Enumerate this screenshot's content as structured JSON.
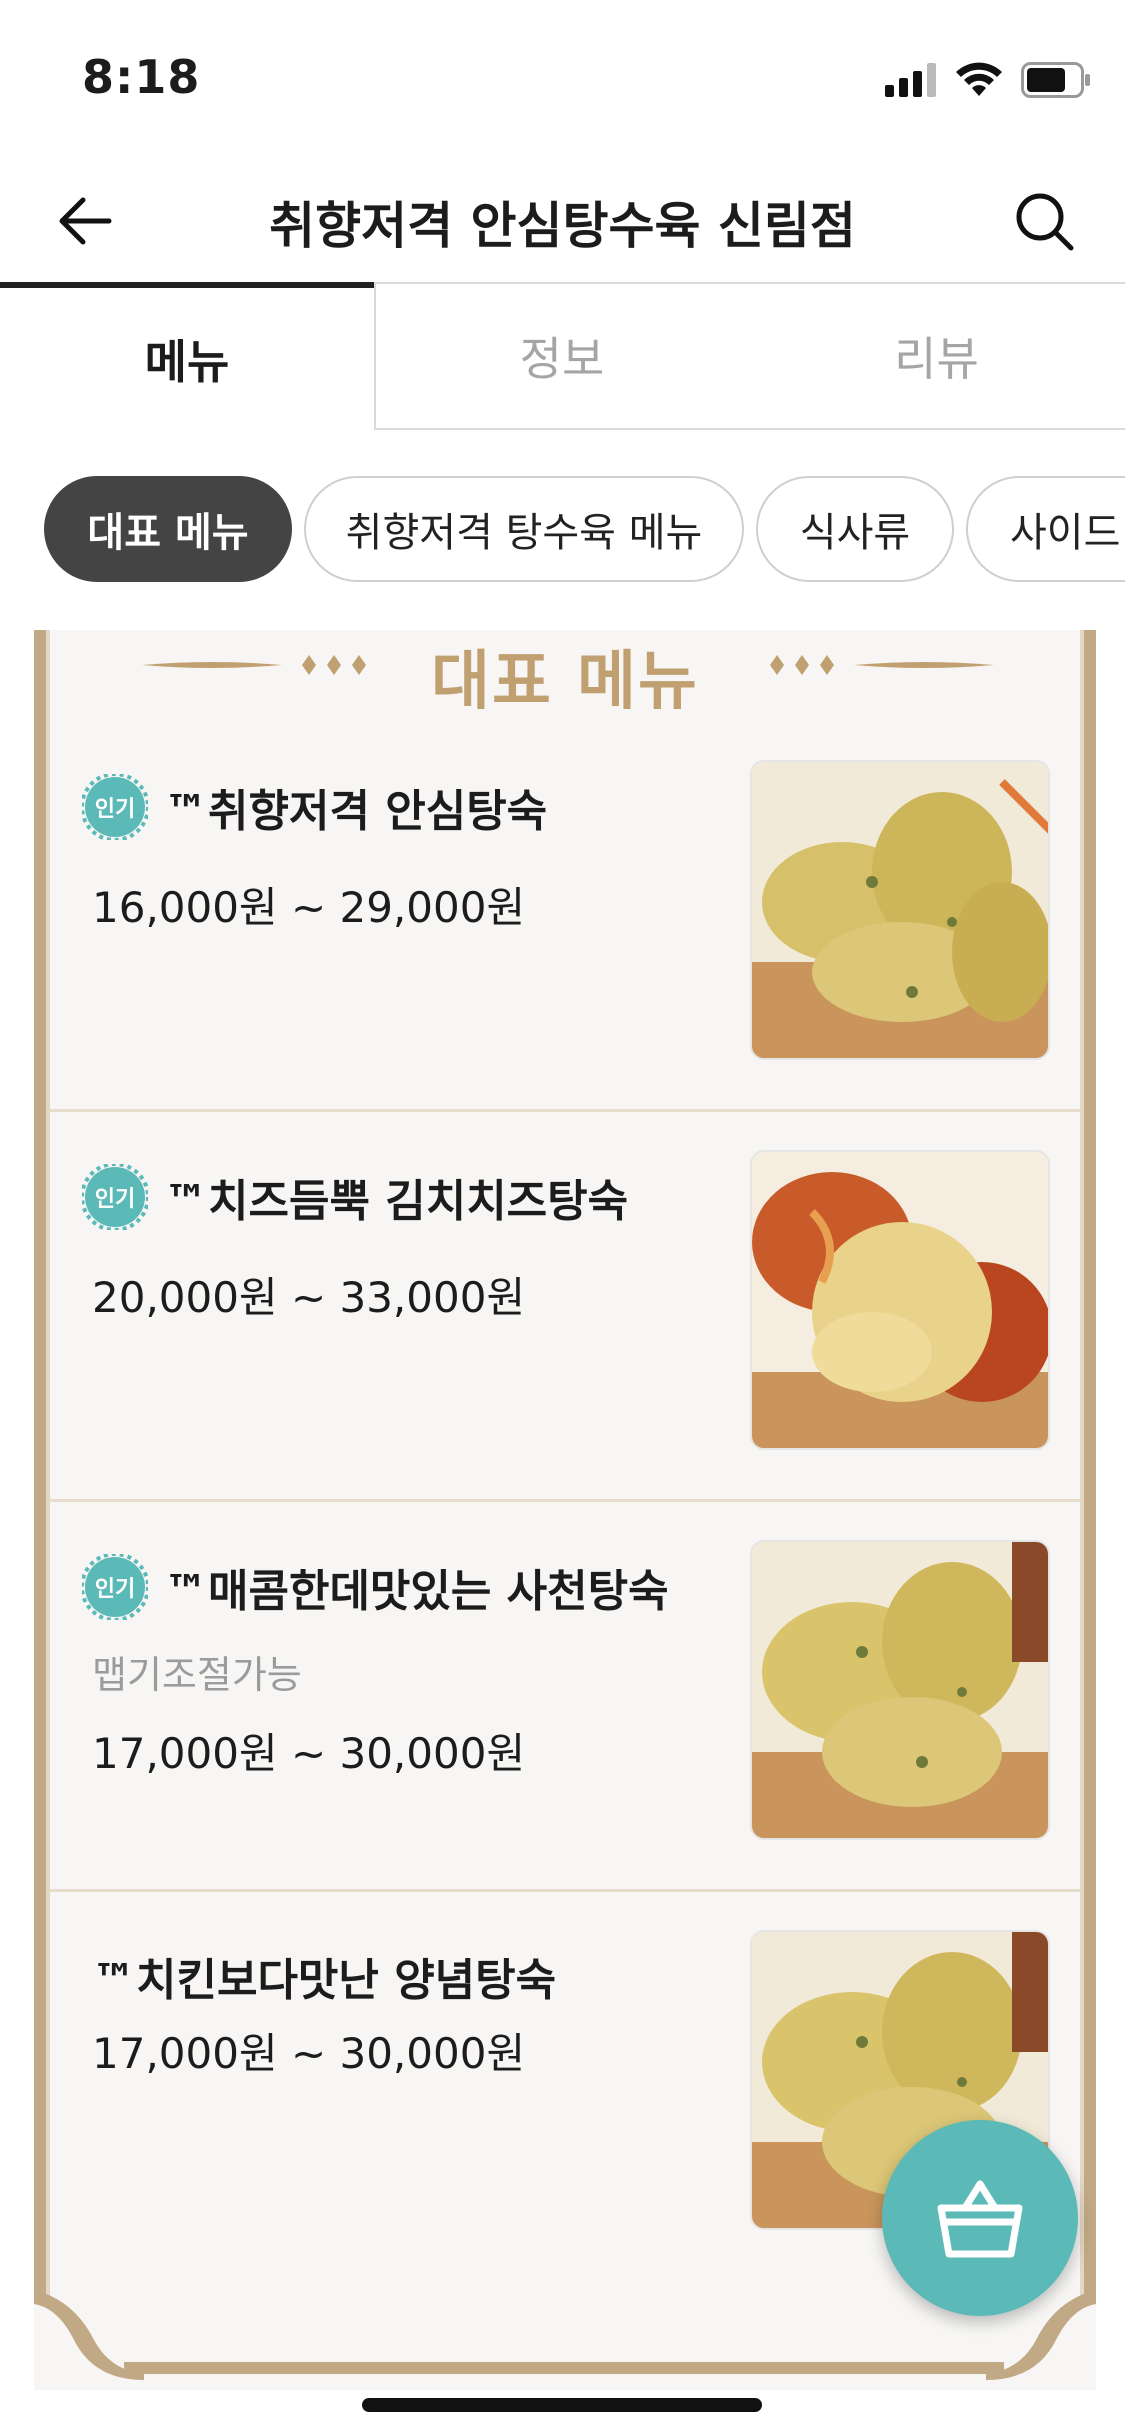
{
  "status": {
    "time": "8:18"
  },
  "header": {
    "title": "취향저격 안심탕수육 신림점"
  },
  "tabs": [
    {
      "label": "메뉴"
    },
    {
      "label": "정보"
    },
    {
      "label": "리뷰"
    }
  ],
  "chips": [
    {
      "label": "대표 메뉴"
    },
    {
      "label": "취향저격 탕수육 메뉴"
    },
    {
      "label": "식사류"
    },
    {
      "label": "사이드"
    }
  ],
  "section": {
    "title": "대표 메뉴"
  },
  "items": [
    {
      "badge": "인기",
      "name": "™취향저격 안심탕숙",
      "note": "",
      "price": "16,000원 ~ 29,000원"
    },
    {
      "badge": "인기",
      "name": "™치즈듬뿍 김치치즈탕숙",
      "note": "",
      "price": "20,000원 ~ 33,000원"
    },
    {
      "badge": "인기",
      "name": "™매콤한데맛있는 사천탕숙",
      "note": "맵기조절가능",
      "price": "17,000원 ~ 30,000원"
    },
    {
      "badge": "",
      "name": "™치킨보다맛난 양념탕숙",
      "note": "",
      "price": "17,000원 ~ 30,000원"
    }
  ],
  "colors": {
    "accent": "#5bbab8",
    "frame": "#c2a985",
    "chip_active": "#444444"
  },
  "icons": [
    "back-arrow-icon",
    "search-icon",
    "cart-basket-icon",
    "signal-icon",
    "wifi-icon",
    "battery-icon"
  ]
}
